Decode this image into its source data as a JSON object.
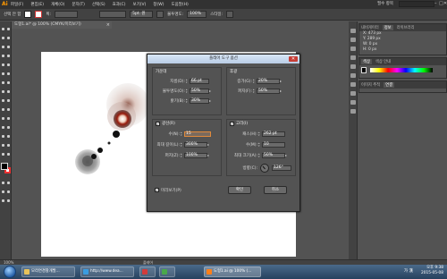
{
  "app": {
    "logo": "Ai",
    "menus": [
      "파일(F)",
      "편집(E)",
      "개체(O)",
      "문자(T)",
      "선택(S)",
      "효과(C)",
      "보기(V)",
      "창(W)",
      "도움말(H)"
    ],
    "workspace_label": "필수 항목",
    "minimize": "–",
    "maximize": "□",
    "close": "✕"
  },
  "control_bar": {
    "selection_label": "선택 안 함",
    "stroke_label": "획:",
    "brush_field": "5pt. 원",
    "style_label": "스타일:",
    "opacity_label": "불투명도:",
    "opacity_value": "100%"
  },
  "document_tab": {
    "title": "도형1.ai* @ 100% (CMYK/미리보기)",
    "close": "×"
  },
  "right_panels": {
    "tabs_top": [
      "내비게이터",
      "정보",
      "라이브러리"
    ],
    "info_lines": [
      "X: 473 px",
      "Y: 289 px",
      "W: 0 px",
      "H: 0 px"
    ],
    "color_tabs": [
      "색상",
      "색상 안내"
    ],
    "swatch_tabs": [
      "이미지 추적",
      "연결"
    ],
    "layer_tabs": [
      "브러시",
      "심볼",
      "그래픽 스타일"
    ]
  },
  "dialog": {
    "title": "플레어 도구 옵션",
    "close": "✕",
    "center": {
      "title": "가운데",
      "diameter_label": "지름(D):",
      "diameter": "66 pt",
      "opacity_label": "불투명도(O):",
      "opacity": "50%",
      "brightness_label": "밝기(B):",
      "brightness": "30%"
    },
    "halo": {
      "title": "후광",
      "growth_label": "증가(G):",
      "growth": "20%",
      "fuzziness_label": "퍼지(F):",
      "fuzziness": "50%"
    },
    "rays": {
      "title": "광선(R)",
      "checked": "✓",
      "number_label": "수(N):",
      "number": "15",
      "longest_label": "최대 길이(L):",
      "longest": "300%",
      "fuzziness_label": "퍼지(Z):",
      "fuzziness": "100%"
    },
    "rings": {
      "title": "고리(I)",
      "checked": "✓",
      "path_label": "패스(H):",
      "path": "262 pt",
      "number_label": "수(M):",
      "number": "10",
      "largest_label": "최대 크기(A):",
      "largest": "50%",
      "direction_label": "방향(C):",
      "direction": "126°"
    },
    "preview_label": "미리보기(P)",
    "preview_checked": "✓",
    "ok_label": "확인",
    "cancel_label": "취소"
  },
  "status_bar": {
    "zoom": "100%",
    "tool": "플레어"
  },
  "taskbar": {
    "tasks": [
      "모라연경찰개발...",
      "http://www.dea...",
      "",
      "",
      "도형1.ai @ 100% (..."
    ],
    "language": "가 漢",
    "time": "오후 9:38",
    "date": "2015-05-08"
  },
  "colors": {
    "accent": "#e08a3c",
    "flare_core": "#9a1c0c",
    "taskbar": "#27415e"
  }
}
